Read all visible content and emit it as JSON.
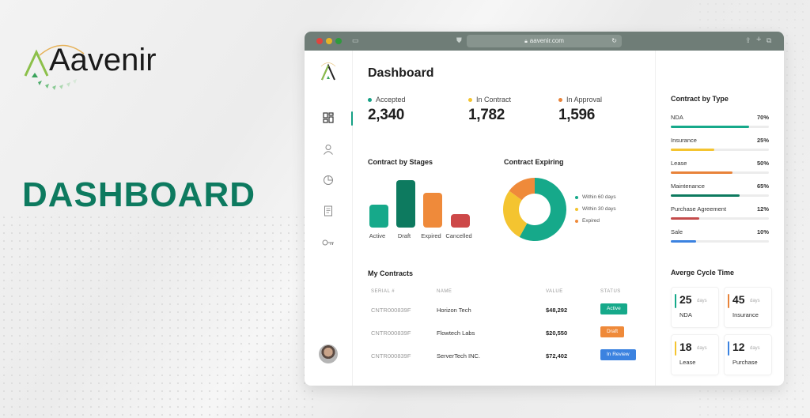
{
  "brand": {
    "name": "Aavenir",
    "headline": "DASHBOARD"
  },
  "browser": {
    "url": "aavenir.com"
  },
  "sidebar": {
    "items": [
      {
        "name": "dashboard",
        "icon": "grid-icon",
        "active": true
      },
      {
        "name": "users",
        "icon": "user-icon",
        "active": false
      },
      {
        "name": "reports",
        "icon": "pie-chart-icon",
        "active": false
      },
      {
        "name": "documents",
        "icon": "document-icon",
        "active": false
      },
      {
        "name": "keys",
        "icon": "key-icon",
        "active": false
      }
    ]
  },
  "main": {
    "title": "Dashboard",
    "stats": [
      {
        "label": "Accepted",
        "value": "2,340",
        "color": "#16a085"
      },
      {
        "label": "In Contract",
        "value": "1,782",
        "color": "#f4c430"
      },
      {
        "label": "In Approval",
        "value": "1,596",
        "color": "#e8833a"
      }
    ],
    "contracts_title": "My Contracts",
    "table": {
      "headers": [
        "SERIAL #",
        "NAME",
        "VALUE",
        "STATUS"
      ],
      "rows": [
        {
          "serial": "CNTR000839F",
          "name": "Horizon Tech",
          "value": "$48,292",
          "status": "Active",
          "status_color": "#16a085"
        },
        {
          "serial": "CNTR000839F",
          "name": "Flowtech Labs",
          "value": "$20,550",
          "status": "Draft",
          "status_color": "#e8833a"
        },
        {
          "serial": "CNTR000839F",
          "name": "ServerTech INC.",
          "value": "$72,402",
          "status": "In Review",
          "status_color": "#3b82e0"
        }
      ]
    }
  },
  "chart_data": [
    {
      "type": "bar",
      "title": "Contract by Stages",
      "categories": [
        "Active",
        "Draft",
        "Expired",
        "Cancelled"
      ],
      "values": [
        29,
        60,
        44,
        17
      ],
      "colors": [
        "#16a98a",
        "#0d7a5f",
        "#ef8a3a",
        "#cd4848"
      ],
      "xlabel": "",
      "ylabel": "",
      "ylim": [
        0,
        60
      ]
    },
    {
      "type": "pie",
      "title": "Contract Expiring",
      "categories": [
        "Within 60 days",
        "Within 30 days",
        "Expired"
      ],
      "values": [
        58,
        27,
        15
      ],
      "colors": [
        "#16a98a",
        "#f4c430",
        "#ef8a3a"
      ],
      "legend": "right"
    }
  ],
  "contract_by_type": {
    "title": "Contract  by Type",
    "items": [
      {
        "label": "NDA",
        "pct_label": "70%",
        "pct": 0.8,
        "color": "#16a98a"
      },
      {
        "label": "Insurance",
        "pct_label": "25%",
        "pct": 0.44,
        "color": "#f4c430"
      },
      {
        "label": "Lease",
        "pct_label": "50%",
        "pct": 0.63,
        "color": "#e8833a"
      },
      {
        "label": "Maintenance",
        "pct_label": "65%",
        "pct": 0.7,
        "color": "#0d7a5f"
      },
      {
        "label": "Purchase Agreement",
        "pct_label": "12%",
        "pct": 0.29,
        "color": "#c44b4b"
      },
      {
        "label": "Sale",
        "pct_label": "10%",
        "pct": 0.26,
        "color": "#3b82e0"
      }
    ]
  },
  "cycle_time": {
    "title": "Averge Cycle Time",
    "unit": "days",
    "cards": [
      {
        "value": "25",
        "label": "NDA",
        "color": "#16a98a"
      },
      {
        "value": "45",
        "label": "Insurance",
        "color": "#e8833a"
      },
      {
        "value": "18",
        "label": "Lease",
        "color": "#f4c430"
      },
      {
        "value": "12",
        "label": "Purchase",
        "color": "#3b82e0"
      }
    ]
  }
}
